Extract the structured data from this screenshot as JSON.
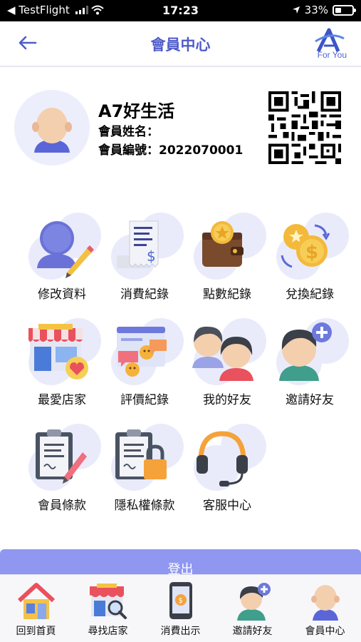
{
  "status_bar": {
    "carrier": "◀ TestFlight",
    "time": "17:23",
    "battery": "33%"
  },
  "header": {
    "title": "會員中心",
    "logo_text": "For You"
  },
  "profile": {
    "name": "A7好生活",
    "member_name_label": "會員姓名：",
    "member_id_label": "會員編號：2022070001"
  },
  "menu": [
    {
      "label": "修改資料",
      "icon": "edit-profile-icon"
    },
    {
      "label": "消費紀錄",
      "icon": "receipt-icon"
    },
    {
      "label": "點數紀錄",
      "icon": "wallet-icon"
    },
    {
      "label": "兌換紀錄",
      "icon": "exchange-coins-icon"
    },
    {
      "label": "最愛店家",
      "icon": "favorite-store-icon"
    },
    {
      "label": "評價紀錄",
      "icon": "review-icon"
    },
    {
      "label": "我的好友",
      "icon": "friends-icon"
    },
    {
      "label": "邀請好友",
      "icon": "invite-friend-icon"
    },
    {
      "label": "會員條款",
      "icon": "clipboard-terms-icon"
    },
    {
      "label": "隱私權條款",
      "icon": "privacy-lock-icon"
    },
    {
      "label": "客服中心",
      "icon": "headset-icon"
    }
  ],
  "logout_label": "登出",
  "tabs": [
    {
      "label": "回到首頁",
      "icon": "home-icon"
    },
    {
      "label": "尋找店家",
      "icon": "store-search-icon"
    },
    {
      "label": "消費出示",
      "icon": "phone-pay-icon"
    },
    {
      "label": "邀請好友",
      "icon": "invite-friend-icon"
    },
    {
      "label": "會員中心",
      "icon": "member-avatar-icon"
    }
  ],
  "colors": {
    "accent": "#4f5cc9",
    "blob": "#e9ebfb",
    "logout": "#8f97f0"
  }
}
